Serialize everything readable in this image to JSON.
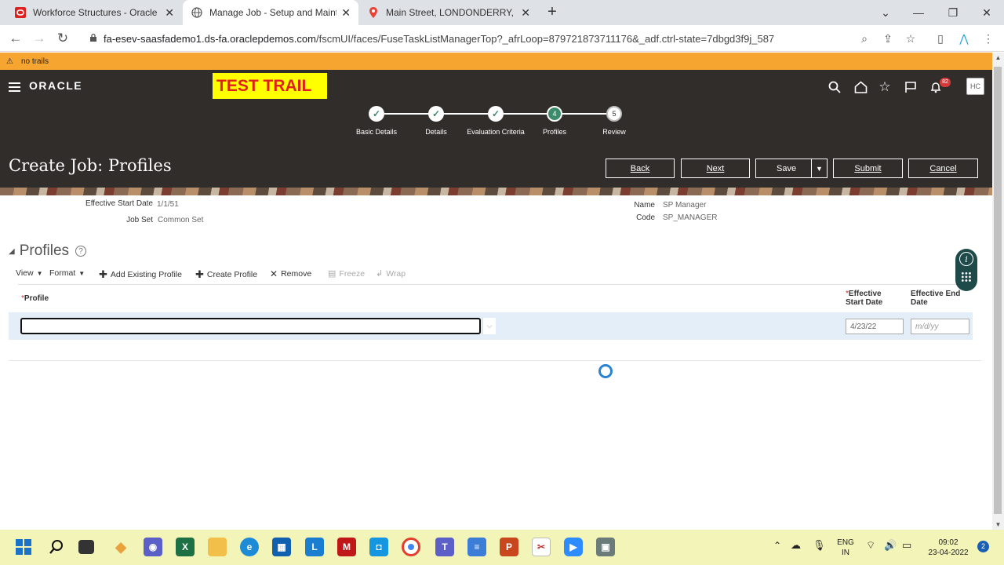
{
  "browser": {
    "tabs": [
      {
        "title": "Workforce Structures - Oracle Fu",
        "icon": "oracle-icon"
      },
      {
        "title": "Manage Job - Setup and Mainte",
        "icon": "globe-icon"
      },
      {
        "title": "Main Street, LONDONDERRY, No",
        "icon": "maps-pin-icon"
      }
    ],
    "url_host": "fa-esev-saasfademo1.ds-fa.oraclepdemos.com",
    "url_path": "/fscmUI/faces/FuseTaskListManagerTop?_afrLoop=879721873711176&_adf.ctrl-state=7dbgd3f9j_587"
  },
  "notice": "no trails",
  "header": {
    "logo": "ORACLE",
    "test_trail": "TEST TRAIL",
    "notification_count": "82",
    "avatar": "HC"
  },
  "train": [
    {
      "label": "Basic Details",
      "state": "done",
      "num": "✓"
    },
    {
      "label": "Details",
      "state": "done",
      "num": "✓"
    },
    {
      "label": "Evaluation Criteria",
      "state": "done",
      "num": "✓"
    },
    {
      "label": "Profiles",
      "state": "current",
      "num": "4"
    },
    {
      "label": "Review",
      "state": "todo",
      "num": "5"
    }
  ],
  "page_title": "Create Job: Profiles",
  "buttons": {
    "back": "Back",
    "next": "Next",
    "save": "Save",
    "submit": "Submit",
    "cancel": "Cancel"
  },
  "info": {
    "eff_start_label": "Effective Start Date",
    "eff_start_value": "1/1/51",
    "job_set_label": "Job Set",
    "job_set_value": "Common Set",
    "name_label": "Name",
    "name_value": "SP Manager",
    "code_label": "Code",
    "code_value": "SP_MANAGER"
  },
  "section": {
    "title": "Profiles"
  },
  "toolbar": {
    "view": "View",
    "format": "Format",
    "add_existing": "Add Existing Profile",
    "create": "Create Profile",
    "remove": "Remove",
    "freeze": "Freeze",
    "wrap": "Wrap"
  },
  "table": {
    "col_profile": "Profile",
    "col_start_1": "Effective",
    "col_start_2": "Start Date",
    "col_end_1": "Effective End",
    "col_end_2": "Date",
    "row": {
      "profile_value": "",
      "start_value": "4/23/22",
      "end_placeholder": "m/d/yy"
    }
  },
  "taskbar": {
    "lang_1": "ENG",
    "lang_2": "IN",
    "time": "09:02",
    "date": "23-04-2022",
    "notif": "2"
  }
}
